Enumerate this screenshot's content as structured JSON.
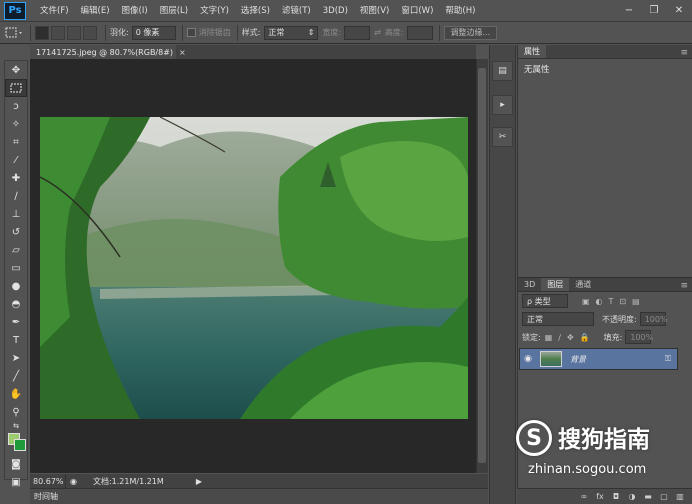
{
  "app": {
    "logo": "Ps"
  },
  "menu": [
    "文件(F)",
    "编辑(E)",
    "图像(I)",
    "图层(L)",
    "文字(Y)",
    "选择(S)",
    "滤镜(T)",
    "3D(D)",
    "视图(V)",
    "窗口(W)",
    "帮助(H)"
  ],
  "window_controls": {
    "minimize": "−",
    "restore": "❐",
    "close": "✕"
  },
  "options": {
    "feather_label": "羽化:",
    "feather_value": "0 像素",
    "antialias_label": "消除锯齿",
    "style_label": "样式:",
    "style_value": "正常",
    "width_label": "宽度:",
    "height_label": "高度:",
    "refine_edge": "调整边缘..."
  },
  "document": {
    "tab_title": "17141725.jpeg @ 80.7%(RGB/8#)",
    "close": "×",
    "zoom": "80.67%",
    "doc_info": "文档:1.21M/1.21M"
  },
  "timeline_label": "时间轴",
  "panels": {
    "properties": {
      "tab": "属性",
      "content": "无属性"
    },
    "layers": {
      "tabs": [
        "3D",
        "图层",
        "通道"
      ],
      "filter_label": "ρ 类型",
      "blend_mode": "正常",
      "opacity_label": "不透明度:",
      "opacity_value": "100%",
      "lock_label": "锁定:",
      "fill_label": "填充:",
      "fill_value": "100%",
      "layer_name": "背景"
    }
  },
  "watermark": {
    "brand": "搜狗指南",
    "url": "zhinan.sogou.com",
    "logo_glyph": "S"
  },
  "colors": {
    "accent": "#31a8ff",
    "selected_layer": "#5a74a0",
    "canvas_bg": "#282828"
  }
}
